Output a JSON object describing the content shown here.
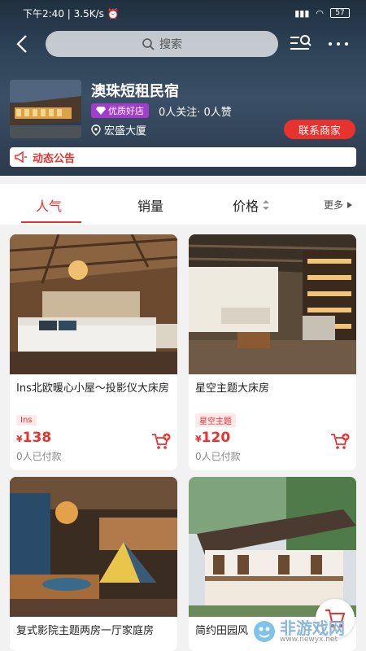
{
  "status_bar": {
    "time": "下午2:40",
    "speed": "3.5K/s",
    "battery": "57"
  },
  "header": {
    "search_placeholder": "搜索"
  },
  "shop": {
    "name": "澳珠短租民宿",
    "badge": "优质好店",
    "follow_text": "0人关注· 0人赞",
    "address": "宏盛大厦",
    "contact_label": "联系商家",
    "notice_label": "动态公告"
  },
  "sort_tabs": {
    "popular": "人气",
    "sales": "销量",
    "price": "价格",
    "more": "更多"
  },
  "products": [
    {
      "title": "Ins北欧暖心小屋～投影仪大床房",
      "tag": "Ins",
      "price": "138",
      "sold": "0人已付款"
    },
    {
      "title": "星空主题大床房",
      "tag": "星空主题",
      "price": "120",
      "sold": "0人已付款"
    },
    {
      "title": "复式影院主题两房一厅家庭房",
      "tag": "",
      "price": "",
      "sold": ""
    },
    {
      "title": "简约田园风",
      "tag": "",
      "price": "",
      "sold": ""
    }
  ],
  "currency_symbol": "¥",
  "watermark": {
    "text": "非游戏网",
    "url": "www.newyx.net"
  }
}
